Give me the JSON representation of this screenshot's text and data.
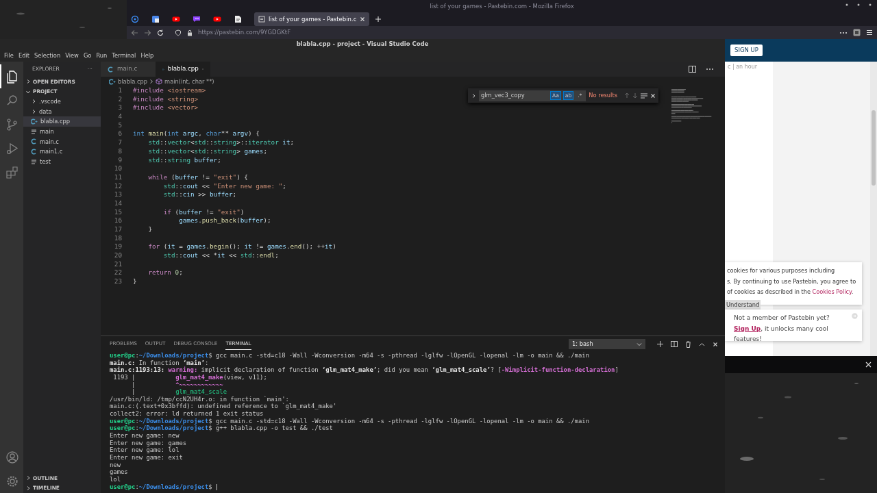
{
  "firefox": {
    "title": "list of your games - Pastebin.com - Mozilla Firefox",
    "pinned_tabs": [
      {
        "kind": "ring"
      },
      {
        "kind": "translate"
      },
      {
        "kind": "video"
      },
      {
        "kind": "chat"
      },
      {
        "kind": "video"
      },
      {
        "kind": "note"
      }
    ],
    "tab": {
      "title": "list of your games - Pastebin.c",
      "selected": true
    },
    "url": "https://pastebin.com/9YGDGKtF"
  },
  "pastebin": {
    "signup": "SIGN UP",
    "meta": "c | an hour",
    "cookie_lines": [
      "cookies for various purposes including",
      "s. By continuing to use Pastebin, you agree to"
    ],
    "cookie_last": {
      "before": "of cookies as described in the ",
      "link": "Cookies Policy",
      "after": "."
    },
    "cookie_button": "Understand",
    "notice": {
      "before": "Not a member of Pastebin yet? ",
      "link": "Sign Up",
      "after": ", it unlocks many cool features!"
    }
  },
  "vscode": {
    "title": "blabla.cpp - project - Visual Studio Code",
    "menu": [
      "File",
      "Edit",
      "Selection",
      "View",
      "Go",
      "Run",
      "Terminal",
      "Help"
    ],
    "activity_bar": [
      {
        "kind": "files",
        "selected": true
      },
      {
        "kind": "search",
        "selected": false
      },
      {
        "kind": "source-control",
        "selected": false
      },
      {
        "kind": "run",
        "selected": false
      },
      {
        "kind": "extensions",
        "selected": false
      }
    ],
    "activity_bottom": [
      {
        "kind": "account"
      },
      {
        "kind": "settings"
      }
    ],
    "sidebar": {
      "title": "EXPLORER",
      "more": "···",
      "sections": [
        {
          "label": "OPEN EDITORS",
          "expanded": false
        },
        {
          "label": "PROJECT",
          "expanded": true,
          "children": [
            {
              "label": ".vscode",
              "kind": "folder",
              "expanded": false,
              "selected": false
            },
            {
              "label": "data",
              "kind": "folder",
              "expanded": false,
              "selected": false
            },
            {
              "label": "blabla.cpp",
              "kind": "cpp",
              "selected": true
            },
            {
              "label": "main",
              "kind": "binary",
              "selected": false
            },
            {
              "label": "main.c",
              "kind": "c",
              "selected": false
            },
            {
              "label": "main1.c",
              "kind": "c",
              "selected": false
            },
            {
              "label": "test",
              "kind": "binary",
              "selected": false
            }
          ]
        }
      ],
      "bottom_sections": [
        {
          "label": "OUTLINE",
          "expanded": false
        },
        {
          "label": "TIMELINE",
          "expanded": false
        }
      ]
    },
    "editor": {
      "tabs": [
        {
          "label": "main.c",
          "kind": "c",
          "selected": false
        },
        {
          "label": "blabla.cpp",
          "kind": "cpp",
          "selected": true
        }
      ],
      "breadcrumb": [
        {
          "label": "blabla.cpp",
          "kind": "cpp"
        },
        {
          "label": "main(int, char **)",
          "kind": "method"
        }
      ],
      "find": {
        "value": "glm_vec3_copy",
        "toggles": [
          {
            "label": "Aa",
            "on": true
          },
          {
            "label": "ab",
            "on": true
          },
          {
            "label": ".*",
            "on": false
          }
        ],
        "status": "No results"
      },
      "lines": [
        {
          "number": "1",
          "tokens": [
            {
              "text": "#include",
              "kind": "directive"
            },
            {
              "text": " <iostream>",
              "kind": "string"
            }
          ]
        },
        {
          "number": "2",
          "tokens": [
            {
              "text": "#include",
              "kind": "directive"
            },
            {
              "text": " <string>",
              "kind": "string"
            }
          ]
        },
        {
          "number": "3",
          "tokens": [
            {
              "text": "#include",
              "kind": "directive"
            },
            {
              "text": " <vector>",
              "kind": "string"
            }
          ]
        },
        {
          "number": "4"
        },
        {
          "number": "5"
        },
        {
          "number": "6",
          "tokens": [
            {
              "text": "int",
              "kind": "keyword"
            },
            {
              "text": " main",
              "kind": "function"
            },
            {
              "text": "(",
              "kind": "plain"
            },
            {
              "text": "int",
              "kind": "keyword"
            },
            {
              "text": " argc",
              "kind": "variable"
            },
            {
              "text": ", ",
              "kind": "plain"
            },
            {
              "text": "char",
              "kind": "keyword"
            },
            {
              "text": "** ",
              "kind": "plain"
            },
            {
              "text": "argv",
              "kind": "variable"
            },
            {
              "text": ") {",
              "kind": "plain"
            }
          ]
        },
        {
          "number": "7",
          "tokens": [
            {
              "text": "    std",
              "kind": "type"
            },
            {
              "text": "::",
              "kind": "plain"
            },
            {
              "text": "vector",
              "kind": "type"
            },
            {
              "text": "<",
              "kind": "plain"
            },
            {
              "text": "std",
              "kind": "type"
            },
            {
              "text": "::",
              "kind": "plain"
            },
            {
              "text": "string",
              "kind": "type"
            },
            {
              "text": ">::",
              "kind": "plain"
            },
            {
              "text": "iterator",
              "kind": "type"
            },
            {
              "text": " it",
              "kind": "variable"
            },
            {
              "text": ";",
              "kind": "plain"
            }
          ]
        },
        {
          "number": "8",
          "tokens": [
            {
              "text": "    std",
              "kind": "type"
            },
            {
              "text": "::",
              "kind": "plain"
            },
            {
              "text": "vector",
              "kind": "type"
            },
            {
              "text": "<",
              "kind": "plain"
            },
            {
              "text": "std",
              "kind": "type"
            },
            {
              "text": "::",
              "kind": "plain"
            },
            {
              "text": "string",
              "kind": "type"
            },
            {
              "text": "> ",
              "kind": "plain"
            },
            {
              "text": "games",
              "kind": "variable"
            },
            {
              "text": ";",
              "kind": "plain"
            }
          ]
        },
        {
          "number": "9",
          "tokens": [
            {
              "text": "    std",
              "kind": "type"
            },
            {
              "text": "::",
              "kind": "plain"
            },
            {
              "text": "string",
              "kind": "type"
            },
            {
              "text": " buffer",
              "kind": "variable"
            },
            {
              "text": ";",
              "kind": "plain"
            }
          ]
        },
        {
          "number": "10"
        },
        {
          "number": "11",
          "tokens": [
            {
              "text": "    while",
              "kind": "control"
            },
            {
              "text": " (",
              "kind": "plain"
            },
            {
              "text": "buffer",
              "kind": "variable"
            },
            {
              "text": " != ",
              "kind": "plain"
            },
            {
              "text": "\"exit\"",
              "kind": "string"
            },
            {
              "text": ") {",
              "kind": "plain"
            }
          ]
        },
        {
          "number": "12",
          "tokens": [
            {
              "text": "        std",
              "kind": "type"
            },
            {
              "text": "::",
              "kind": "plain"
            },
            {
              "text": "cout",
              "kind": "variable"
            },
            {
              "text": " << ",
              "kind": "plain"
            },
            {
              "text": "\"Enter new game: \"",
              "kind": "string"
            },
            {
              "text": ";",
              "kind": "plain"
            }
          ]
        },
        {
          "number": "13",
          "tokens": [
            {
              "text": "        std",
              "kind": "type"
            },
            {
              "text": "::",
              "kind": "plain"
            },
            {
              "text": "cin",
              "kind": "variable"
            },
            {
              "text": " >> ",
              "kind": "plain"
            },
            {
              "text": "buffer",
              "kind": "variable"
            },
            {
              "text": ";",
              "kind": "plain"
            }
          ]
        },
        {
          "number": "14"
        },
        {
          "number": "15",
          "tokens": [
            {
              "text": "        if",
              "kind": "control"
            },
            {
              "text": " (",
              "kind": "plain"
            },
            {
              "text": "buffer",
              "kind": "variable"
            },
            {
              "text": " != ",
              "kind": "plain"
            },
            {
              "text": "\"exit\"",
              "kind": "string"
            },
            {
              "text": ")",
              "kind": "plain"
            }
          ]
        },
        {
          "number": "16",
          "tokens": [
            {
              "text": "            games",
              "kind": "variable"
            },
            {
              "text": ".",
              "kind": "plain"
            },
            {
              "text": "push_back",
              "kind": "function"
            },
            {
              "text": "(",
              "kind": "plain"
            },
            {
              "text": "buffer",
              "kind": "variable"
            },
            {
              "text": ");",
              "kind": "plain"
            }
          ]
        },
        {
          "number": "17",
          "tokens": [
            {
              "text": "    }",
              "kind": "plain"
            }
          ]
        },
        {
          "number": "18"
        },
        {
          "number": "19",
          "tokens": [
            {
              "text": "    for",
              "kind": "control"
            },
            {
              "text": " (",
              "kind": "plain"
            },
            {
              "text": "it",
              "kind": "variable"
            },
            {
              "text": " = ",
              "kind": "plain"
            },
            {
              "text": "games",
              "kind": "variable"
            },
            {
              "text": ".",
              "kind": "plain"
            },
            {
              "text": "begin",
              "kind": "function"
            },
            {
              "text": "(); ",
              "kind": "plain"
            },
            {
              "text": "it",
              "kind": "variable"
            },
            {
              "text": " != ",
              "kind": "plain"
            },
            {
              "text": "games",
              "kind": "variable"
            },
            {
              "text": ".",
              "kind": "plain"
            },
            {
              "text": "end",
              "kind": "function"
            },
            {
              "text": "(); ++",
              "kind": "plain"
            },
            {
              "text": "it",
              "kind": "variable"
            },
            {
              "text": ")",
              "kind": "plain"
            }
          ]
        },
        {
          "number": "20",
          "tokens": [
            {
              "text": "        std",
              "kind": "type"
            },
            {
              "text": "::",
              "kind": "plain"
            },
            {
              "text": "cout",
              "kind": "variable"
            },
            {
              "text": " << *",
              "kind": "plain"
            },
            {
              "text": "it",
              "kind": "variable"
            },
            {
              "text": " << ",
              "kind": "plain"
            },
            {
              "text": "std",
              "kind": "type"
            },
            {
              "text": "::",
              "kind": "plain"
            },
            {
              "text": "endl",
              "kind": "function"
            },
            {
              "text": ";",
              "kind": "plain"
            }
          ]
        },
        {
          "number": "21"
        },
        {
          "number": "22",
          "tokens": [
            {
              "text": "    return",
              "kind": "control"
            },
            {
              "text": " 0",
              "kind": "number"
            },
            {
              "text": ";",
              "kind": "plain"
            }
          ]
        },
        {
          "number": "23",
          "tokens": [
            {
              "text": "}",
              "kind": "plain"
            }
          ]
        }
      ]
    },
    "panel": {
      "tabs": [
        {
          "label": "PROBLEMS",
          "selected": false
        },
        {
          "label": "OUTPUT",
          "selected": false
        },
        {
          "label": "DEBUG CONSOLE",
          "selected": false
        },
        {
          "label": "TERMINAL",
          "selected": true
        }
      ],
      "terminal_select": "1: bash",
      "lines": [
        {
          "segments": [
            {
              "text": "user@pc",
              "kind": "user"
            },
            {
              "text": ":",
              "kind": "plain"
            },
            {
              "text": "~/Downloads/project",
              "kind": "path"
            },
            {
              "text": "$ gcc main.c -std=c18 -Wall -Wconversion -m64 -s -pthread -lglfw -lOpenGL -lopenal -lm -o main && ./main",
              "kind": "plain"
            }
          ]
        },
        {
          "segments": [
            {
              "text": "main.c:",
              "kind": "bold"
            },
            {
              "text": " In function ",
              "kind": "plain"
            },
            {
              "text": "‘main’",
              "kind": "bold"
            },
            {
              "text": ":",
              "kind": "plain"
            }
          ]
        },
        {
          "segments": [
            {
              "text": "main.c:1193:13: ",
              "kind": "bold"
            },
            {
              "text": "warning:",
              "kind": "warning"
            },
            {
              "text": " implicit declaration of function ",
              "kind": "plain"
            },
            {
              "text": "‘glm_mat4_make’",
              "kind": "bold"
            },
            {
              "text": "; did you mean ",
              "kind": "plain"
            },
            {
              "text": "‘glm_mat4_scale’",
              "kind": "bold"
            },
            {
              "text": "? [",
              "kind": "plain"
            },
            {
              "text": "-Wimplicit-function-declaration",
              "kind": "warning"
            },
            {
              "text": "]",
              "kind": "plain"
            }
          ]
        },
        {
          "segments": [
            {
              "text": " 1193 |           ",
              "kind": "plain"
            },
            {
              "text": "glm_mat4_make",
              "kind": "warning"
            },
            {
              "text": "(view, v11);",
              "kind": "plain"
            }
          ]
        },
        {
          "segments": [
            {
              "text": "      |           ",
              "kind": "plain"
            },
            {
              "text": "^~~~~~~~~~~~~",
              "kind": "warning"
            }
          ]
        },
        {
          "segments": [
            {
              "text": "      |           ",
              "kind": "plain"
            },
            {
              "text": "glm_mat4_scale",
              "kind": "hint"
            }
          ]
        },
        {
          "segments": [
            {
              "text": "/usr/bin/ld: /tmp/ccN2UH4r.o: in function `main':",
              "kind": "plain"
            }
          ]
        },
        {
          "segments": [
            {
              "text": "main.c:(.text+0x3bffd): undefined reference to `glm_mat4_make'",
              "kind": "plain"
            }
          ]
        },
        {
          "segments": [
            {
              "text": "collect2: error: ld returned 1 exit status",
              "kind": "plain"
            }
          ]
        },
        {
          "segments": [
            {
              "text": "user@pc",
              "kind": "user"
            },
            {
              "text": ":",
              "kind": "plain"
            },
            {
              "text": "~/Downloads/project",
              "kind": "path"
            },
            {
              "text": "$ gcc main.c -std=c18 -Wall -Wconversion -m64 -s -pthread -lglfw -lOpenGL -lopenal -lm -o main && ./main",
              "kind": "plain"
            }
          ]
        },
        {
          "segments": [
            {
              "text": "user@pc",
              "kind": "user"
            },
            {
              "text": ":",
              "kind": "plain"
            },
            {
              "text": "~/Downloads/project",
              "kind": "path"
            },
            {
              "text": "$ g++ blabla.cpp -o test && ./test",
              "kind": "plain"
            }
          ]
        },
        {
          "segments": [
            {
              "text": "Enter new game: new",
              "kind": "plain"
            }
          ]
        },
        {
          "segments": [
            {
              "text": "Enter new game: games",
              "kind": "plain"
            }
          ]
        },
        {
          "segments": [
            {
              "text": "Enter new game: lol",
              "kind": "plain"
            }
          ]
        },
        {
          "segments": [
            {
              "text": "Enter new game: exit",
              "kind": "plain"
            }
          ]
        },
        {
          "segments": [
            {
              "text": "new",
              "kind": "plain"
            }
          ]
        },
        {
          "segments": [
            {
              "text": "games",
              "kind": "plain"
            }
          ]
        },
        {
          "segments": [
            {
              "text": "lol",
              "kind": "plain"
            }
          ]
        },
        {
          "segments": [
            {
              "text": "user@pc",
              "kind": "user"
            },
            {
              "text": ":",
              "kind": "plain"
            },
            {
              "text": "~/Downloads/project",
              "kind": "path"
            },
            {
              "text": "$",
              "kind": "plain"
            }
          ],
          "cursor": true
        }
      ]
    }
  }
}
